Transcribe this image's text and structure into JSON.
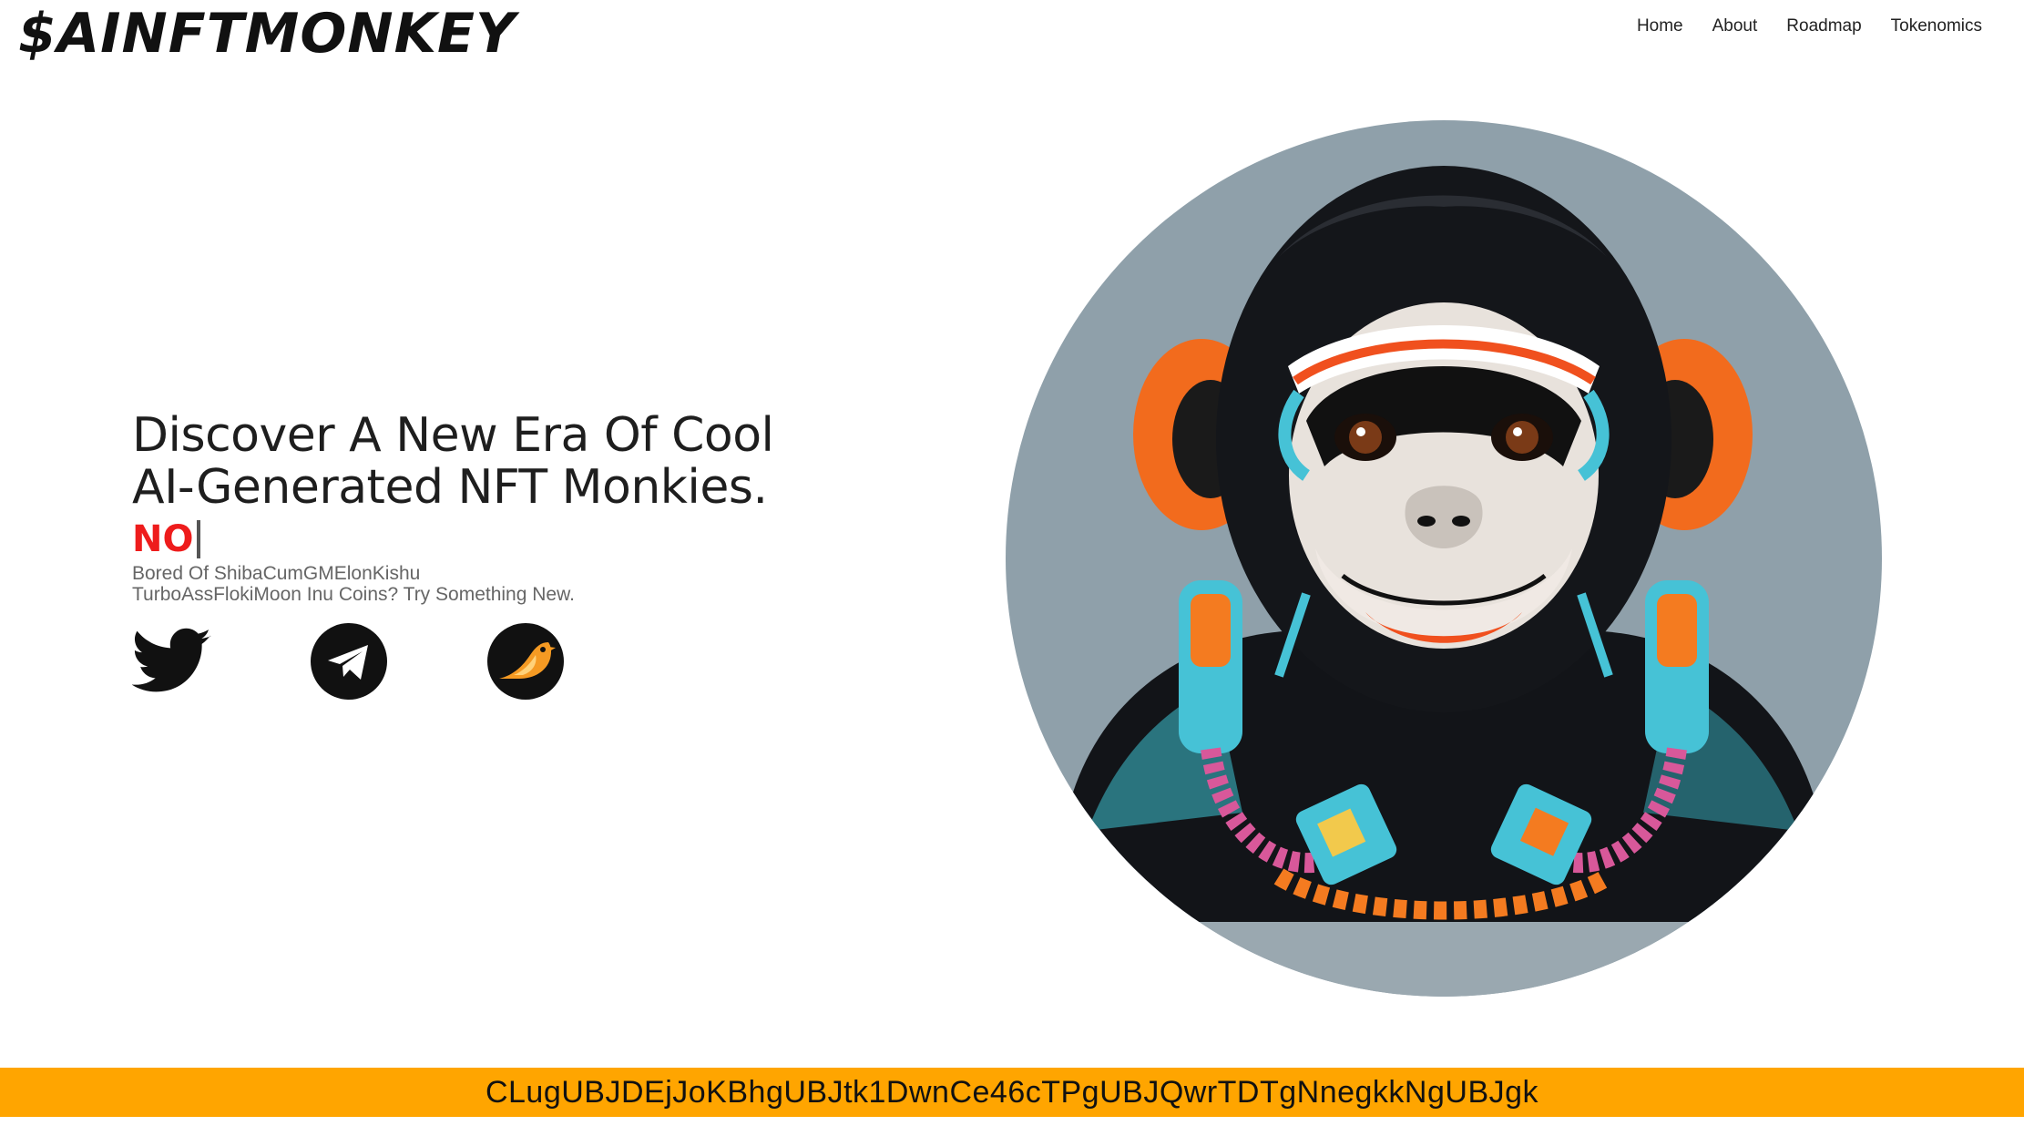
{
  "header": {
    "logo": "$AINFTMONKEY",
    "nav": [
      "Home",
      "About",
      "Roadmap",
      "Tokenomics"
    ]
  },
  "hero": {
    "headline_line1": "Discover A New Era Of Cool",
    "headline_line2": "AI-Generated NFT Monkies.",
    "typed_word": "NO",
    "tagline_line1": "Bored Of ShibaCumGMElonKishu",
    "tagline_line2": "TurboAssFlokiMoon Inu Coins? Try Something New."
  },
  "socials": [
    {
      "name": "twitter-icon",
      "color": "#111111"
    },
    {
      "name": "telegram-icon",
      "color": "#111111"
    },
    {
      "name": "birdeye-icon",
      "color": "#f59a23"
    }
  ],
  "illustration": {
    "subject": "monkey-with-headphones",
    "bg_color": "#8fa0aa"
  },
  "contract": {
    "address": "CLugUBJDEjJoKBhgUBJtk1DwnCe46cTPgUBJQwrTDTgNnegkkNgUBJgk",
    "bar_color": "#ffa500"
  },
  "colors": {
    "accent_red": "#ee1c1c",
    "tagline_gray": "#666666"
  }
}
